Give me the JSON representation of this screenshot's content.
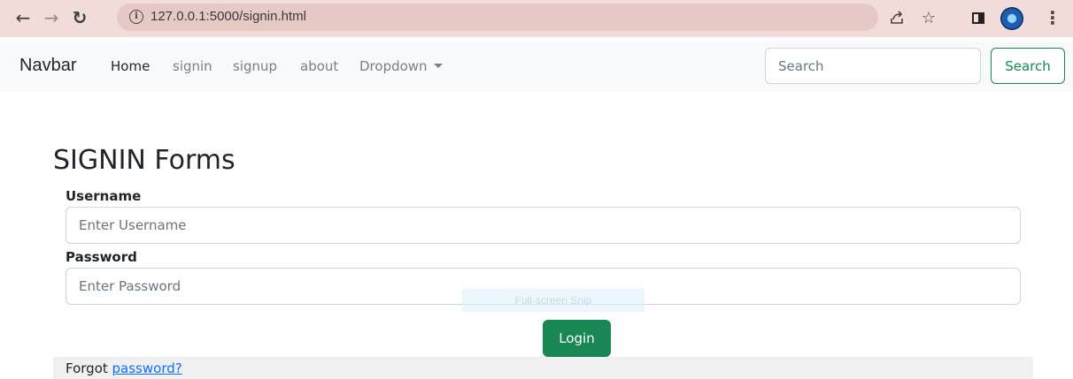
{
  "browser": {
    "url": "127.0.0.1:5000/signin.html",
    "icons": [
      "back-arrow-icon",
      "forward-arrow-icon",
      "reload-icon",
      "info-icon",
      "share-icon",
      "star-icon",
      "side-panel-icon",
      "profile-icon",
      "menu-icon"
    ]
  },
  "navbar": {
    "brand": "Navbar",
    "links": [
      {
        "label": "Home",
        "active": true
      },
      {
        "label": "signin",
        "active": false
      },
      {
        "label": "signup",
        "active": false
      },
      {
        "label": "about",
        "active": false
      },
      {
        "label": "Dropdown",
        "active": false
      }
    ],
    "search_placeholder": "Search",
    "search_button": "Search"
  },
  "form": {
    "title": "SIGNIN Forms",
    "username_label": "Username",
    "username_placeholder": "Enter Username",
    "password_label": "Password",
    "password_placeholder": "Enter Password",
    "login_button": "Login",
    "forgot_text": "Forgot ",
    "forgot_link": "password?"
  },
  "overlay": {
    "text": "Full-screen Snip"
  },
  "colors": {
    "accent_green": "#198754",
    "link_blue": "#0d6efd",
    "chrome_bg": "#f1dcd9"
  }
}
